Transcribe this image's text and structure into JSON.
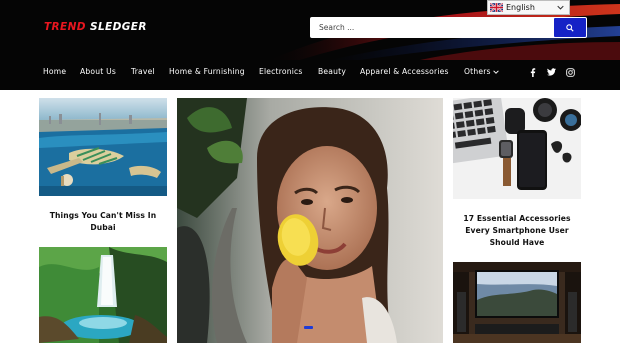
{
  "brand": {
    "part1": "TREND",
    "part2": "SLEDGER"
  },
  "search": {
    "placeholder": "Search ..."
  },
  "language": {
    "selected": "English"
  },
  "nav": {
    "items": [
      "Home",
      "About Us",
      "Travel",
      "Home & Furnishing",
      "Electronics",
      "Beauty",
      "Apparel & Accessories",
      "Others"
    ]
  },
  "social": [
    "facebook-icon",
    "twitter-icon",
    "instagram-icon"
  ],
  "cards": {
    "dubai": {
      "title_line1": "Things You Can't Miss In",
      "title_line2": "Dubai"
    },
    "accessories": {
      "title_line1": "17 Essential Accessories",
      "title_line2": "Every Smartphone User",
      "title_line3": "Should Have"
    }
  },
  "colors": {
    "header_bg": "#050505",
    "brand_red": "#e8161f",
    "search_button": "#1522c6",
    "slider_dot": "#1e3bd6"
  }
}
